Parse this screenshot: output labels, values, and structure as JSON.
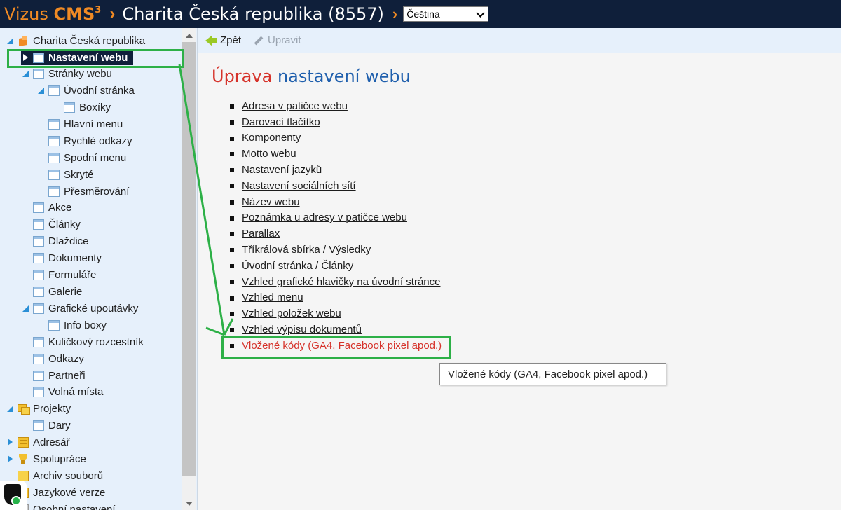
{
  "header": {
    "brand_name": "Vizus",
    "brand_cms": "CMS",
    "brand_sup": "3",
    "site_title": "Charita Česká republika (8557)",
    "language": "Čeština"
  },
  "sidebar": {
    "root": "Charita Česká republika",
    "items": {
      "nastaveni_webu": "Nastavení webu",
      "stranky_webu": "Stránky webu",
      "uvodni_stranka": "Úvodní stránka",
      "boxiky": "Boxíky",
      "hlavni_menu": "Hlavní menu",
      "rychle_odkazy": "Rychlé odkazy",
      "spodni_menu": "Spodní menu",
      "skryte": "Skryté",
      "presmerovani": "Přesměrování",
      "akce": "Akce",
      "clanky": "Články",
      "dlazdice": "Dlaždice",
      "dokumenty": "Dokumenty",
      "formulare": "Formuláře",
      "galerie": "Galerie",
      "graficke_upoutavky": "Grafické upoutávky",
      "info_boxy": "Info boxy",
      "kulickovy_rozcestnik": "Kuličkový rozcestník",
      "odkazy": "Odkazy",
      "partneri": "Partneři",
      "volna_mista": "Volná místa",
      "projekty": "Projekty",
      "dary": "Dary",
      "adresar": "Adresář",
      "spoluprace": "Spolupráce",
      "archiv_souboru": "Archiv souborů",
      "jazykove_verze": "Jazykové verze",
      "osobni_nastaveni": "Osobní nastavení"
    }
  },
  "toolbar": {
    "back_label": "Zpět",
    "edit_label": "Upravit"
  },
  "main": {
    "title_part1": "Úprava",
    "title_part2": "nastavení webu",
    "links": [
      "Adresa v patičce webu",
      "Darovací tlačítko",
      "Komponenty",
      "Motto webu",
      "Nastavení jazyků",
      "Nastavení sociálních sítí",
      "Název webu",
      "Poznámka u adresy v patičce webu",
      "Parallax",
      "Tříkrálová sbírka / Výsledky",
      "Úvodní stránka / Články",
      "Vzhled grafické hlavičky na úvodní stránce",
      "Vzhled menu",
      "Vzhled položek webu",
      "Vzhled výpisu dokumentů",
      "Vložené kódy (GA4, Facebook pixel apod.)"
    ],
    "tooltip": "Vložené kódy (GA4, Facebook pixel apod.)"
  },
  "colors": {
    "header_bg": "#0f1f3a",
    "brand_orange": "#f08a24",
    "sidebar_bg": "#e6f0fb",
    "title_red": "#d6322a",
    "title_blue": "#1f5fad",
    "annotation_green": "#2db047"
  }
}
